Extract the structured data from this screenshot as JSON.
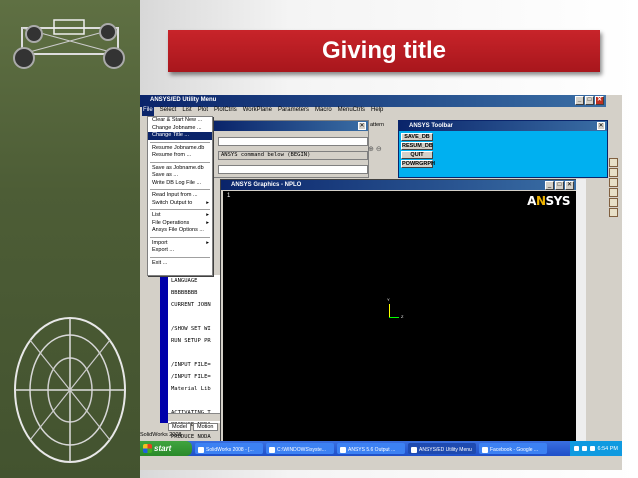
{
  "slide": {
    "title": "Giving title"
  },
  "ansys": {
    "window_title": "ANSYS/ED Utility Menu",
    "menu": [
      "File",
      "Select",
      "List",
      "Plot",
      "PlotCtrls",
      "WorkPlane",
      "Parameters",
      "Macro",
      "MenuCtrls",
      "Help"
    ],
    "file_menu": [
      {
        "label": "Clear & Start New ...",
        "highlight": false
      },
      {
        "label": "Change Jobname ...",
        "highlight": false
      },
      {
        "label": "Change Title ...",
        "highlight": true
      },
      {
        "sep": true
      },
      {
        "label": "Resume Jobname.db",
        "highlight": false
      },
      {
        "label": "Resume from ...",
        "highlight": false
      },
      {
        "sep": true
      },
      {
        "label": "Save as Jobname.db",
        "highlight": false
      },
      {
        "label": "Save as ...",
        "highlight": false
      },
      {
        "label": "Write DB Log File ...",
        "highlight": false
      },
      {
        "sep": true
      },
      {
        "label": "Read Input from ...",
        "highlight": false
      },
      {
        "label": "Switch Output to",
        "highlight": false,
        "submenu": true
      },
      {
        "sep": true
      },
      {
        "label": "List",
        "highlight": false,
        "submenu": true
      },
      {
        "label": "File Operations",
        "highlight": false,
        "submenu": true
      },
      {
        "label": "Ansys File Options ...",
        "highlight": false
      },
      {
        "sep": true
      },
      {
        "label": "Import",
        "highlight": false,
        "submenu": true
      },
      {
        "label": "Export ...",
        "highlight": false
      },
      {
        "sep": true
      },
      {
        "label": "Exit ...",
        "highlight": false
      }
    ],
    "input_prompt": "ANSYS command below (BEGIN)",
    "pattern_label": "attern",
    "toolbar": {
      "title": "ANSYS Toolbar",
      "buttons": [
        "SAVE_DB",
        "RESUM_DB",
        "QUIT",
        "POWRGRPH"
      ]
    },
    "graphics": {
      "title": "ANSYS Graphics - NPLO",
      "window_number": "1",
      "logo_pre": "A",
      "logo_n": "N",
      "logo_post": "SYS",
      "axis_y": "Y",
      "axis_z": "Z"
    },
    "output_lines": [
      "LANGUAGE",
      "BBBBBBBB",
      "CURRENT JOBN",
      "",
      "/SHOW SET WI",
      "RUN SETUP PR",
      "",
      "/INPUT FILE=",
      "/INPUT FILE=",
      "Material Lib",
      "",
      "ACTIVATING T",
      "PRODUCE NODA",
      "PRODUCE NODA"
    ],
    "model_tabs": [
      "Model",
      "Motion"
    ],
    "sw_label": "SolidWorks 2008"
  },
  "taskbar": {
    "start": "start",
    "items": [
      {
        "label": "SolidWorks 2008 - [...",
        "active": false
      },
      {
        "label": "C:\\WINDOWS\\syste...",
        "active": false
      },
      {
        "label": "ANSYS 5.6 Output ...",
        "active": false
      },
      {
        "label": "ANSYS/ED Utility Menu",
        "active": true
      },
      {
        "label": "Facebook - Google ...",
        "active": false
      }
    ],
    "clock": "6:54 PM"
  },
  "colors": {
    "title_red": "#b81c22",
    "window_bar": "#0a246a",
    "toolbar_bg": "#00b0f0",
    "taskbar": "#2a5bd7"
  }
}
